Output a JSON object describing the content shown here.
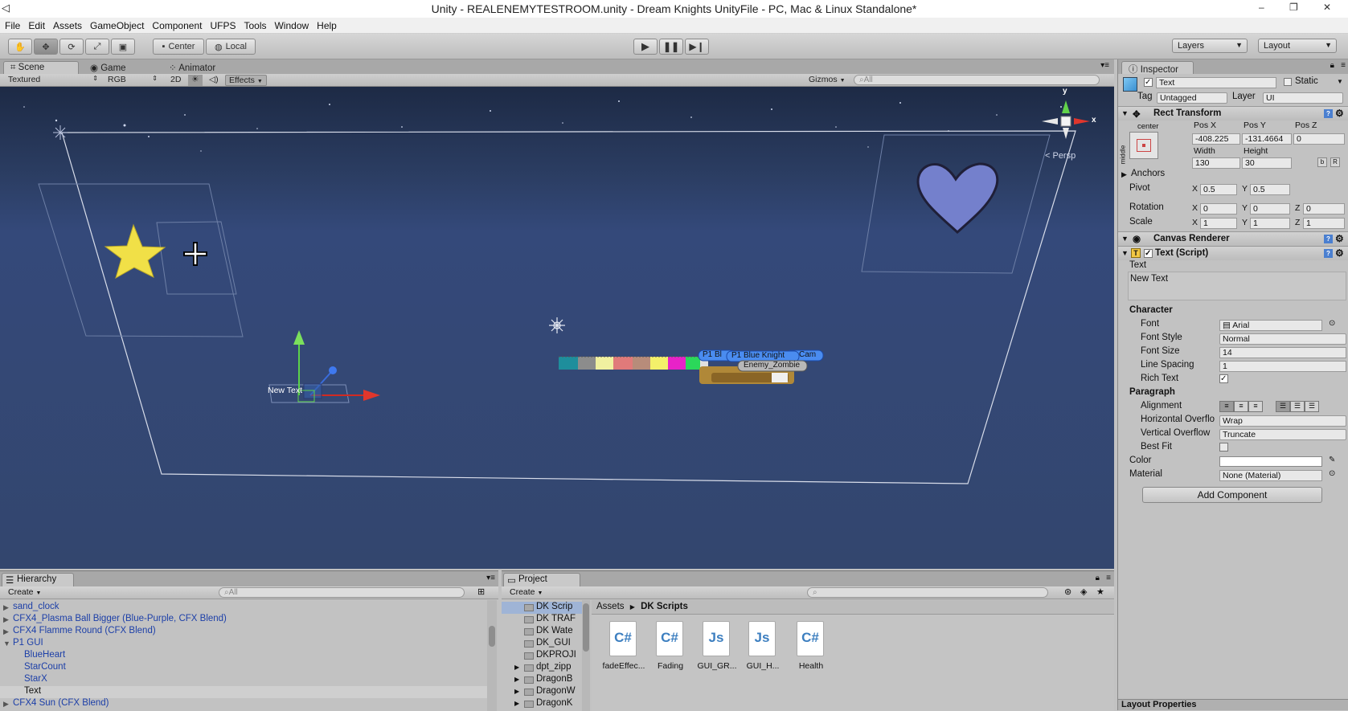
{
  "window": {
    "title": "Unity - REALENEMYTESTROOM.unity - Dream Knights UnityFile - PC, Mac & Linux Standalone*",
    "controls": [
      "–",
      "❐",
      "✕"
    ]
  },
  "menu": [
    "File",
    "Edit",
    "Assets",
    "GameObject",
    "Component",
    "UFPS",
    "Tools",
    "Window",
    "Help"
  ],
  "toolbar": {
    "pivot": "Center",
    "space": "Local",
    "layers": "Layers",
    "layout": "Layout"
  },
  "scene": {
    "tabs": [
      "Scene",
      "Game",
      "Animator"
    ],
    "draw_mode": "Textured",
    "render_mode": "RGB",
    "mode_2d": "2D",
    "effects": "Effects",
    "gizmos": "Gizmos",
    "search_placeholder": "All",
    "persp_label": "< Persp",
    "axis_y": "y",
    "axis_x": "x",
    "new_text_label": "New Text",
    "label_p1_blue_knight": "P1 Blue Knight",
    "label_p1_bl": "P1 Bl",
    "label_cam": "Cam",
    "label_enemy_zombie": "Enemy_Zombie"
  },
  "inspector": {
    "tab": "Inspector",
    "object_name": "Text",
    "static_label": "Static",
    "tag_label": "Tag",
    "tag_value": "Untagged",
    "layer_label": "Layer",
    "layer_value": "UI",
    "rect_transform": {
      "title": "Rect Transform",
      "anchor_preset": "center",
      "side_label": "middle",
      "pos_x_label": "Pos X",
      "pos_y_label": "Pos Y",
      "pos_z_label": "Pos Z",
      "pos_x": "-408.225",
      "pos_y": "-131.4664",
      "pos_z": "0",
      "width_label": "Width",
      "height_label": "Height",
      "width": "130",
      "height": "30",
      "anchors_label": "Anchors",
      "pivot_label": "Pivot",
      "pivot_x": "0.5",
      "pivot_y": "0.5",
      "rotation_label": "Rotation",
      "rot_x": "0",
      "rot_y": "0",
      "rot_z": "0",
      "scale_label": "Scale",
      "scale_x": "1",
      "scale_y": "1",
      "scale_z": "1",
      "x": "X",
      "y": "Y",
      "z": "Z"
    },
    "canvas_renderer": {
      "title": "Canvas Renderer"
    },
    "text_script": {
      "title": "Text (Script)",
      "text_label": "Text",
      "text_value": "New Text",
      "character_label": "Character",
      "font_label": "Font",
      "font_value": "Arial",
      "font_style_label": "Font Style",
      "font_style_value": "Normal",
      "font_size_label": "Font Size",
      "font_size_value": "14",
      "line_spacing_label": "Line Spacing",
      "line_spacing_value": "1",
      "rich_text_label": "Rich Text",
      "paragraph_label": "Paragraph",
      "alignment_label": "Alignment",
      "horizontal_overflow_label": "Horizontal Overflo",
      "horizontal_overflow_value": "Wrap",
      "vertical_overflow_label": "Vertical Overflow",
      "vertical_overflow_value": "Truncate",
      "best_fit_label": "Best Fit",
      "color_label": "Color",
      "color_value": "#ffffff",
      "material_label": "Material",
      "material_value": "None (Material)"
    },
    "add_component": "Add Component",
    "layout_properties": "Layout Properties"
  },
  "hierarchy": {
    "tab": "Hierarchy",
    "create": "Create",
    "search_placeholder": "All",
    "items": [
      {
        "label": "sand_clock",
        "indent": 0,
        "color": "blue",
        "arrow": true
      },
      {
        "label": "CFX4_Plasma Ball Bigger (Blue-Purple, CFX Blend)",
        "indent": 0,
        "color": "blue",
        "arrow": true
      },
      {
        "label": "CFX4 Flamme Round (CFX Blend)",
        "indent": 0,
        "color": "blue",
        "arrow": true
      },
      {
        "label": "P1 GUI",
        "indent": 0,
        "color": "blue",
        "arrow": true
      },
      {
        "label": "BlueHeart",
        "indent": 1,
        "color": "blue",
        "arrow": false
      },
      {
        "label": "StarCount",
        "indent": 1,
        "color": "blue",
        "arrow": false
      },
      {
        "label": "StarX",
        "indent": 1,
        "color": "blue",
        "arrow": false
      },
      {
        "label": "Text",
        "indent": 1,
        "color": "black",
        "arrow": false,
        "selected": true
      },
      {
        "label": "CFX4 Sun (CFX Blend)",
        "indent": 0,
        "color": "blue",
        "arrow": true
      }
    ]
  },
  "project": {
    "tab": "Project",
    "create": "Create",
    "folders": [
      "DK Scrip",
      "DK TRAF",
      "DK Wate",
      "DK_GUI",
      "DKPROJI",
      "dpt_zipp",
      "DragonB",
      "DragonW",
      "DragonK"
    ],
    "breadcrumb_root": "Assets",
    "breadcrumb_current": "DK Scripts",
    "files": [
      {
        "name": "fadeEffec...",
        "type": "C#"
      },
      {
        "name": "Fading",
        "type": "C#"
      },
      {
        "name": "GUI_GR...",
        "type": "Js"
      },
      {
        "name": "GUI_H...",
        "type": "Js"
      },
      {
        "name": "Health",
        "type": "C#"
      }
    ]
  }
}
